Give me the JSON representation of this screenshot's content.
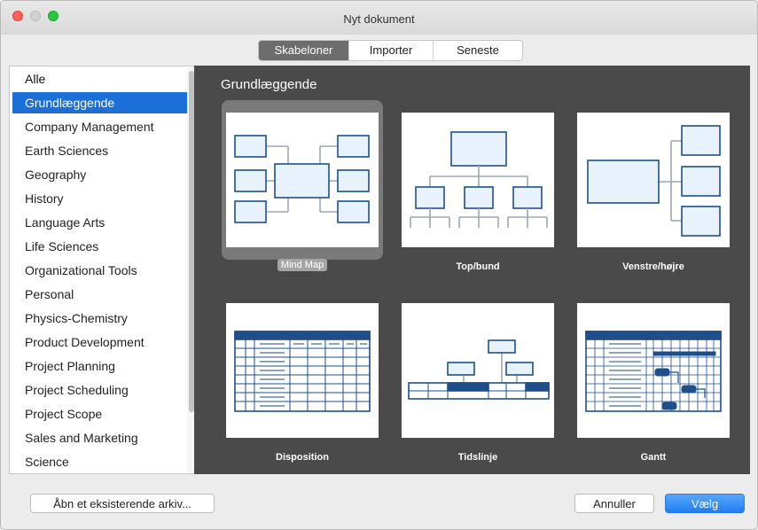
{
  "window": {
    "title": "Nyt dokument"
  },
  "tabs": [
    {
      "label": "Skabeloner",
      "active": true
    },
    {
      "label": "Importer",
      "active": false
    },
    {
      "label": "Seneste",
      "active": false
    }
  ],
  "sidebar": {
    "items": [
      {
        "label": "Alle"
      },
      {
        "label": "Grundlæggende",
        "selected": true
      },
      {
        "label": "Company Management"
      },
      {
        "label": "Earth Sciences"
      },
      {
        "label": "Geography"
      },
      {
        "label": "History"
      },
      {
        "label": "Language Arts"
      },
      {
        "label": "Life Sciences"
      },
      {
        "label": "Organizational Tools"
      },
      {
        "label": "Personal"
      },
      {
        "label": "Physics-Chemistry"
      },
      {
        "label": "Product Development"
      },
      {
        "label": "Project Planning"
      },
      {
        "label": "Project Scheduling"
      },
      {
        "label": "Project Scope"
      },
      {
        "label": "Sales and Marketing"
      },
      {
        "label": "Science"
      }
    ]
  },
  "gallery": {
    "title": "Grundlæggende",
    "templates": [
      {
        "label": "Mind Map",
        "selected": true
      },
      {
        "label": "Top/bund"
      },
      {
        "label": "Venstre/højre"
      },
      {
        "label": "Disposition"
      },
      {
        "label": "Tidslinje"
      },
      {
        "label": "Gantt"
      }
    ]
  },
  "footer": {
    "open_label": "Åbn et eksisterende arkiv...",
    "cancel_label": "Annuller",
    "ok_label": "Vælg"
  },
  "colors": {
    "accent": "#1b6fd6",
    "diagram_stroke": "#1e4f8a",
    "diagram_fill": "#e8f2fc"
  }
}
